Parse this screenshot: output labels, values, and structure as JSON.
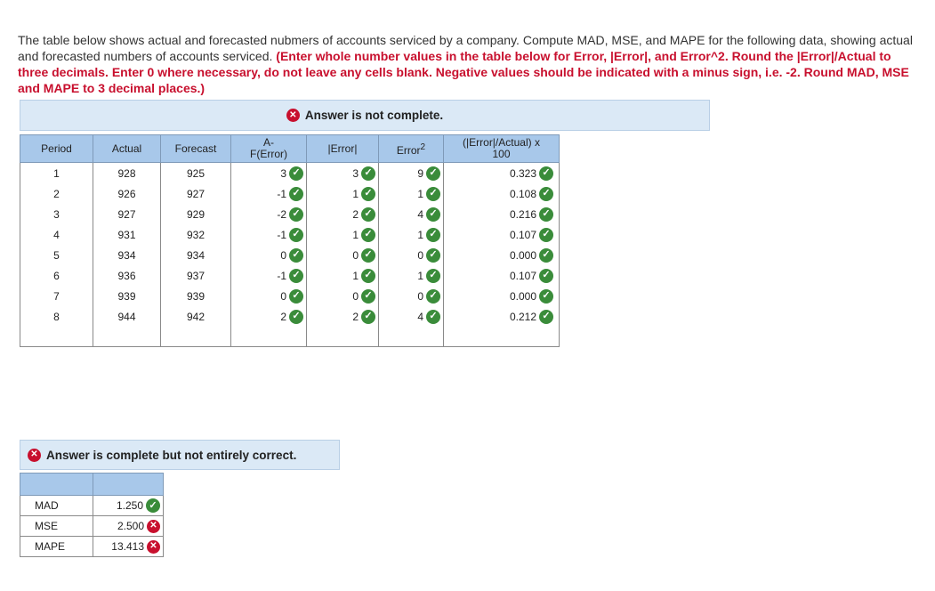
{
  "instructions": {
    "text": "The table below shows actual and forecasted nubmers of accounts serviced by a company. Compute MAD, MSE, and MAPE for the following data, showing actual and forecasted numbers of accounts serviced. ",
    "emphasis": "(Enter whole number values in the table below for Error, |Error|, and Error^2. Round the |Error|/Actual to three decimals. Enter 0 where necessary, do not leave any cells blank. Negative values should be indicated with a minus sign, i.e. -2. Round MAD, MSE and MAPE to 3 decimal places.)"
  },
  "banner_top": {
    "text": "Answer is not complete.",
    "icon": "x-icon"
  },
  "table": {
    "headers": {
      "period": "Period",
      "actual": "Actual",
      "forecast": "Forecast",
      "error_line1": "A-",
      "error_line2": "F(Error)",
      "abs_error": "|Error|",
      "error_sq": "Error",
      "error_sq_sup": "2",
      "pct_line1": "(|Error|/Actual) x",
      "pct_line2": "100"
    },
    "rows": [
      {
        "period": "1",
        "actual": "928",
        "forecast": "925",
        "error": "3",
        "abs_error": "3",
        "error_sq": "9",
        "pct": "0.323"
      },
      {
        "period": "2",
        "actual": "926",
        "forecast": "927",
        "error": "-1",
        "abs_error": "1",
        "error_sq": "1",
        "pct": "0.108"
      },
      {
        "period": "3",
        "actual": "927",
        "forecast": "929",
        "error": "-2",
        "abs_error": "2",
        "error_sq": "4",
        "pct": "0.216"
      },
      {
        "period": "4",
        "actual": "931",
        "forecast": "932",
        "error": "-1",
        "abs_error": "1",
        "error_sq": "1",
        "pct": "0.107"
      },
      {
        "period": "5",
        "actual": "934",
        "forecast": "934",
        "error": "0",
        "abs_error": "0",
        "error_sq": "0",
        "pct": "0.000"
      },
      {
        "period": "6",
        "actual": "936",
        "forecast": "937",
        "error": "-1",
        "abs_error": "1",
        "error_sq": "1",
        "pct": "0.107"
      },
      {
        "period": "7",
        "actual": "939",
        "forecast": "939",
        "error": "0",
        "abs_error": "0",
        "error_sq": "0",
        "pct": "0.000"
      },
      {
        "period": "8",
        "actual": "944",
        "forecast": "942",
        "error": "2",
        "abs_error": "2",
        "error_sq": "4",
        "pct": "0.212"
      }
    ]
  },
  "banner_bottom": {
    "text": "Answer is complete but not entirely correct.",
    "icon": "x-icon"
  },
  "summary": [
    {
      "label": "MAD",
      "value": "1.250",
      "status": "correct"
    },
    {
      "label": "MSE",
      "value": "2.500",
      "status": "incorrect"
    },
    {
      "label": "MAPE",
      "value": "13.413",
      "status": "incorrect"
    }
  ],
  "colors": {
    "header_bg": "#a8c8ea",
    "banner_bg": "#dbe9f6",
    "correct": "#3a8c3a",
    "incorrect": "#c8102e",
    "emphasis": "#c8102e"
  }
}
